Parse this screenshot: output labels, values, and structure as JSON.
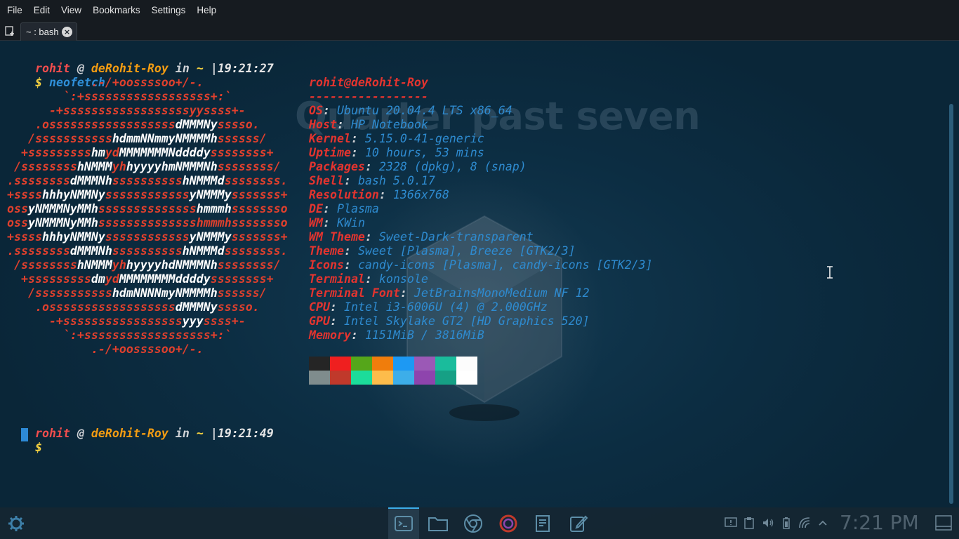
{
  "menubar": {
    "items": [
      "File",
      "Edit",
      "View",
      "Bookmarks",
      "Settings",
      "Help"
    ]
  },
  "tab": {
    "label": "~ : bash"
  },
  "wallpaper_clock": "Quarter past seven",
  "prompt1": {
    "user": "rohit",
    "at": "@",
    "host": "deRohit-Roy",
    "in": "in",
    "dir": "~",
    "sep": "|",
    "time": "19:21:27",
    "dollar": "$",
    "command": "neofetch"
  },
  "prompt2": {
    "user": "rohit",
    "at": "@",
    "host": "deRohit-Roy",
    "in": "in",
    "dir": "~",
    "sep": "|",
    "time": "19:21:49",
    "dollar": "$"
  },
  "logo_lines": [
    [
      [
        "r",
        "            .-/+oossssoo+/-."
      ]
    ],
    [
      [
        "r",
        "        `:+ssssssssssssssssss+:`"
      ]
    ],
    [
      [
        "r",
        "      -+ssssssssssssssssssyyssss+-"
      ]
    ],
    [
      [
        "r",
        "    .ossssssssssssssssss"
      ],
      [
        "w",
        "dMMMNy"
      ],
      [
        "r",
        "sssso."
      ]
    ],
    [
      [
        "r",
        "   /sssssssssss"
      ],
      [
        "w",
        "hdmmNNmmyNMMMMh"
      ],
      [
        "r",
        "ssssss/"
      ]
    ],
    [
      [
        "r",
        "  +sssssssss"
      ],
      [
        "w",
        "hm"
      ],
      [
        "r",
        "yd"
      ],
      [
        "w",
        "MMMMMMMNddddy"
      ],
      [
        "r",
        "ssssssss+"
      ]
    ],
    [
      [
        "r",
        " /ssssssss"
      ],
      [
        "w",
        "hNMMM"
      ],
      [
        "r",
        "yh"
      ],
      [
        "w",
        "hyyyyhmNMMMNh"
      ],
      [
        "r",
        "ssssssss/"
      ]
    ],
    [
      [
        "r",
        ".ssssssss"
      ],
      [
        "w",
        "dMMMNh"
      ],
      [
        "r",
        "ssssssssss"
      ],
      [
        "w",
        "hNMMMd"
      ],
      [
        "r",
        "ssssssss."
      ]
    ],
    [
      [
        "r",
        "+ssss"
      ],
      [
        "w",
        "hhhyNMMNy"
      ],
      [
        "r",
        "ssssssssssss"
      ],
      [
        "w",
        "yNMMMy"
      ],
      [
        "r",
        "sssssss+"
      ]
    ],
    [
      [
        "r",
        "oss"
      ],
      [
        "w",
        "yNMMMNyMMh"
      ],
      [
        "r",
        "ssssssssssssss"
      ],
      [
        "w",
        "hmmmh"
      ],
      [
        "r",
        "ssssssso"
      ]
    ],
    [
      [
        "r",
        "oss"
      ],
      [
        "w",
        "yNMMMNyMMh"
      ],
      [
        "r",
        "sssssssssssssshmmmhssssssso"
      ]
    ],
    [
      [
        "r",
        "+ssss"
      ],
      [
        "w",
        "hhhyNMMNy"
      ],
      [
        "r",
        "ssssssssssss"
      ],
      [
        "w",
        "yNMMMy"
      ],
      [
        "r",
        "sssssss+"
      ]
    ],
    [
      [
        "r",
        ".ssssssss"
      ],
      [
        "w",
        "dMMMNh"
      ],
      [
        "r",
        "ssssssssss"
      ],
      [
        "w",
        "hNMMMd"
      ],
      [
        "r",
        "ssssssss."
      ]
    ],
    [
      [
        "r",
        " /ssssssss"
      ],
      [
        "w",
        "hNMMM"
      ],
      [
        "r",
        "yh"
      ],
      [
        "w",
        "hyyyyhdNMMMNh"
      ],
      [
        "r",
        "ssssssss/"
      ]
    ],
    [
      [
        "r",
        "  +sssssssss"
      ],
      [
        "w",
        "dm"
      ],
      [
        "r",
        "yd"
      ],
      [
        "w",
        "MMMMMMMMddddy"
      ],
      [
        "r",
        "ssssssss+"
      ]
    ],
    [
      [
        "r",
        "   /sssssssssss"
      ],
      [
        "w",
        "hdmNNNNmyNMMMMh"
      ],
      [
        "r",
        "ssssss/"
      ]
    ],
    [
      [
        "r",
        "    .ossssssssssssssssss"
      ],
      [
        "w",
        "dMMMNy"
      ],
      [
        "r",
        "sssso."
      ]
    ],
    [
      [
        "r",
        "      -+sssssssssssssssss"
      ],
      [
        "w",
        "yyy"
      ],
      [
        "r",
        "ssss+-"
      ]
    ],
    [
      [
        "r",
        "        `:+ssssssssssssssssss+:`"
      ]
    ],
    [
      [
        "r",
        "            .-/+oossssoo+/-."
      ]
    ]
  ],
  "info": {
    "title": "rohit@deRohit-Roy",
    "underline": "-----------------",
    "rows": [
      {
        "label": "OS",
        "value": "Ubuntu 20.04.4 LTS x86_64"
      },
      {
        "label": "Host",
        "value": "HP Notebook"
      },
      {
        "label": "Kernel",
        "value": "5.15.0-41-generic"
      },
      {
        "label": "Uptime",
        "value": "10 hours, 53 mins"
      },
      {
        "label": "Packages",
        "value": "2328 (dpkg), 8 (snap)"
      },
      {
        "label": "Shell",
        "value": "bash 5.0.17"
      },
      {
        "label": "Resolution",
        "value": "1366x768"
      },
      {
        "label": "DE",
        "value": "Plasma"
      },
      {
        "label": "WM",
        "value": "KWin"
      },
      {
        "label": "WM Theme",
        "value": "Sweet-Dark-transparent"
      },
      {
        "label": "Theme",
        "value": "Sweet [Plasma], Breeze [GTK2/3]"
      },
      {
        "label": "Icons",
        "value": "candy-icons [Plasma], candy-icons [GTK2/3]"
      },
      {
        "label": "Terminal",
        "value": "konsole"
      },
      {
        "label": "Terminal Font",
        "value": "JetBrainsMonoMedium NF 12"
      },
      {
        "label": "CPU",
        "value": "Intel i3-6006U (4) @ 2.000GHz"
      },
      {
        "label": "GPU",
        "value": "Intel Skylake GT2 [HD Graphics 520]"
      },
      {
        "label": "Memory",
        "value": "1151MiB / 3816MiB"
      }
    ]
  },
  "palette": {
    "row1": [
      "#252525",
      "#ef1f1f",
      "#55a61a",
      "#f07d0c",
      "#1d99f3",
      "#9b59b6",
      "#1abc9c",
      "#fcfcfc"
    ],
    "row2": [
      "#7f8c8d",
      "#c0392b",
      "#1cdc9a",
      "#fdbc4b",
      "#3daee9",
      "#8e44ad",
      "#16a085",
      "#ffffff"
    ]
  },
  "panel": {
    "clock": "7:21 PM",
    "launcher_icon": "kde-gear-icon",
    "tasks": [
      "terminal-icon",
      "folder-icon",
      "chrome-icon",
      "firefox-icon",
      "document-viewer-icon",
      "text-editor-icon"
    ],
    "tray": [
      "notification-icon",
      "clipboard-icon",
      "volume-icon",
      "battery-icon",
      "wifi-icon",
      "chevron-up-icon"
    ]
  },
  "colors": {
    "accent": "#3daee9",
    "prompt_user": "#f24d4d",
    "prompt_host": "#f39c12",
    "logo": "#e0402d",
    "info_label": "#e3342f",
    "info_value": "#2e8bd0"
  }
}
